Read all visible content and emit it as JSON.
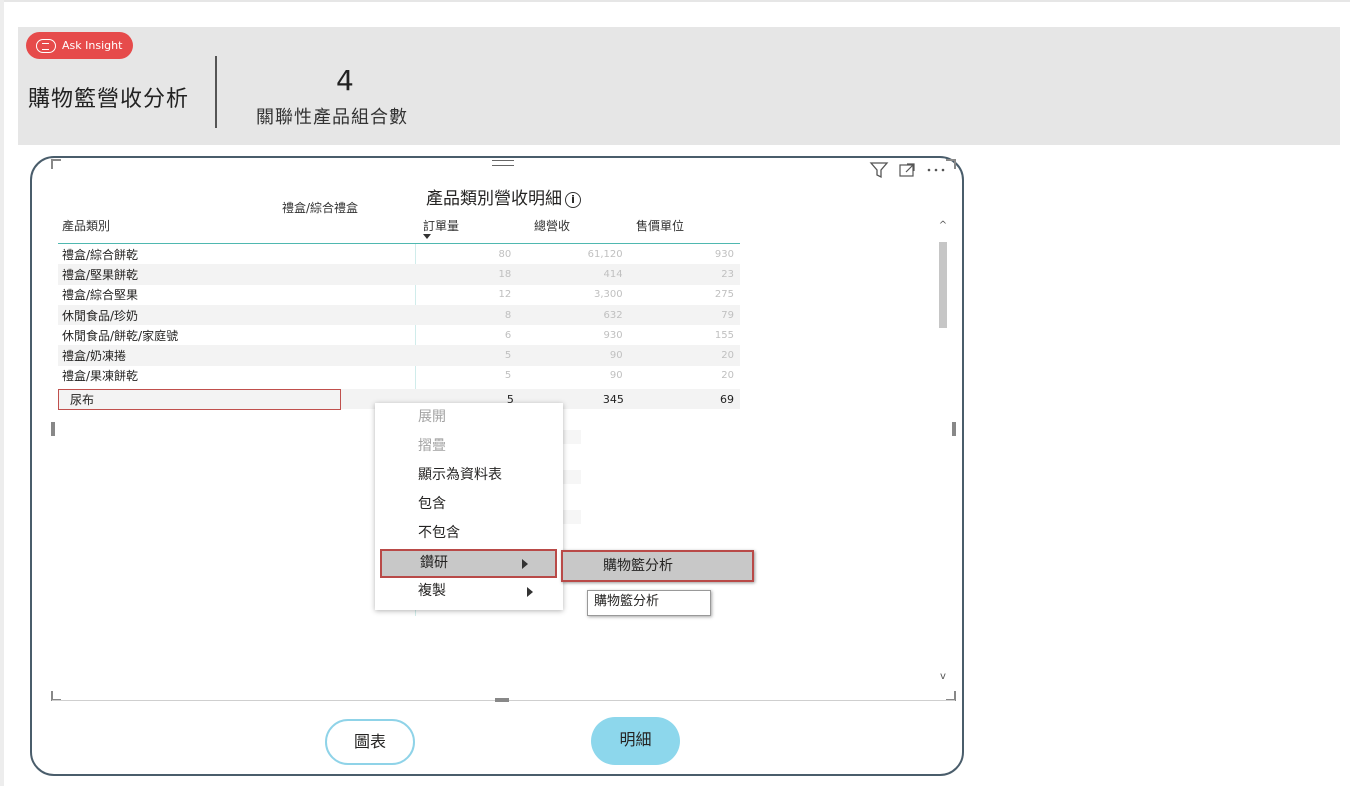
{
  "header": {
    "ask_button": "Ask Insight",
    "page_title": "購物籃營收分析",
    "kpi_value": "4",
    "kpi_label": "關聯性產品組合數"
  },
  "table": {
    "title": "產品類別營收明細",
    "column_group": "禮盒/綜合禮盒",
    "columns": [
      "產品類別",
      "訂單量",
      "總營收",
      "售價單位"
    ],
    "rows": [
      {
        "category": "禮盒/綜合餅乾",
        "orders": "80",
        "revenue": "61,120",
        "unit_price": "930"
      },
      {
        "category": "禮盒/堅果餅乾",
        "orders": "18",
        "revenue": "414",
        "unit_price": "23"
      },
      {
        "category": "禮盒/綜合堅果",
        "orders": "12",
        "revenue": "3,300",
        "unit_price": "275"
      },
      {
        "category": "休閒食品/珍奶",
        "orders": "8",
        "revenue": "632",
        "unit_price": "79"
      },
      {
        "category": "休閒食品/餅乾/家庭號",
        "orders": "6",
        "revenue": "930",
        "unit_price": "155"
      },
      {
        "category": "禮盒/奶凍捲",
        "orders": "5",
        "revenue": "90",
        "unit_price": "20"
      },
      {
        "category": "禮盒/果凍餅乾",
        "orders": "5",
        "revenue": "90",
        "unit_price": "20"
      },
      {
        "category": "尿布",
        "orders": "5",
        "revenue": "345",
        "unit_price": "69"
      }
    ]
  },
  "context_menu": {
    "items": [
      "展開",
      "摺疊",
      "顯示為資料表",
      "包含",
      "不包含",
      "鑽研",
      "複製"
    ],
    "submenu_item": "購物籃分析",
    "tooltip": "購物籃分析"
  },
  "nav": {
    "chart_button": "圖表",
    "detail_button": "明細"
  },
  "colors": {
    "accent_teal": "#4fb8b0",
    "ask_red": "#e64b4b",
    "card_border": "#4a5d6b",
    "highlight_red": "#b94a48",
    "detail_button": "#8dd7ec"
  }
}
